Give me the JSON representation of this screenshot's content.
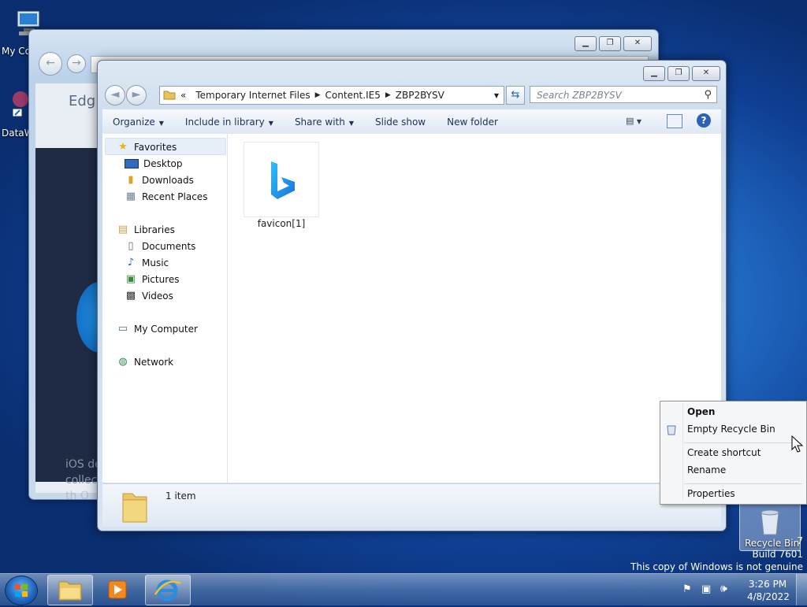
{
  "desktop": {
    "icons": [
      {
        "label": "My Co"
      },
      {
        "label": "DataW"
      },
      {
        "label": "Recycle Bin"
      }
    ],
    "watermark": {
      "partial": "7",
      "build": "Build 7601",
      "genuine": "This copy of Windows is not genuine"
    }
  },
  "back_window": {
    "title_fragment": "Edg",
    "text_lines": [
      "iOS de",
      "collect",
      "th  O"
    ]
  },
  "explorer": {
    "address": {
      "overflow": "«",
      "segments": [
        "Temporary Internet Files",
        "Content.IE5",
        "ZBP2BYSV"
      ]
    },
    "search_placeholder": "Search ZBP2BYSV",
    "toolbar": {
      "organize": "Organize",
      "include": "Include in library",
      "share": "Share with",
      "slideshow": "Slide show",
      "newfolder": "New folder"
    },
    "nav": {
      "favorites": "Favorites",
      "desktop": "Desktop",
      "downloads": "Downloads",
      "recent": "Recent Places",
      "libraries": "Libraries",
      "documents": "Documents",
      "music": "Music",
      "pictures": "Pictures",
      "videos": "Videos",
      "computer": "My Computer",
      "network": "Network"
    },
    "files": [
      {
        "name": "favicon[1]"
      }
    ],
    "status": "1 item"
  },
  "context_menu": {
    "open": "Open",
    "empty": "Empty Recycle Bin",
    "shortcut": "Create shortcut",
    "rename": "Rename",
    "properties": "Properties"
  },
  "taskbar": {
    "time": "3:26 PM",
    "date": "4/8/2022"
  },
  "colors": {
    "accent": "#1f66c0",
    "bing_blue": "#1b8cf0"
  }
}
